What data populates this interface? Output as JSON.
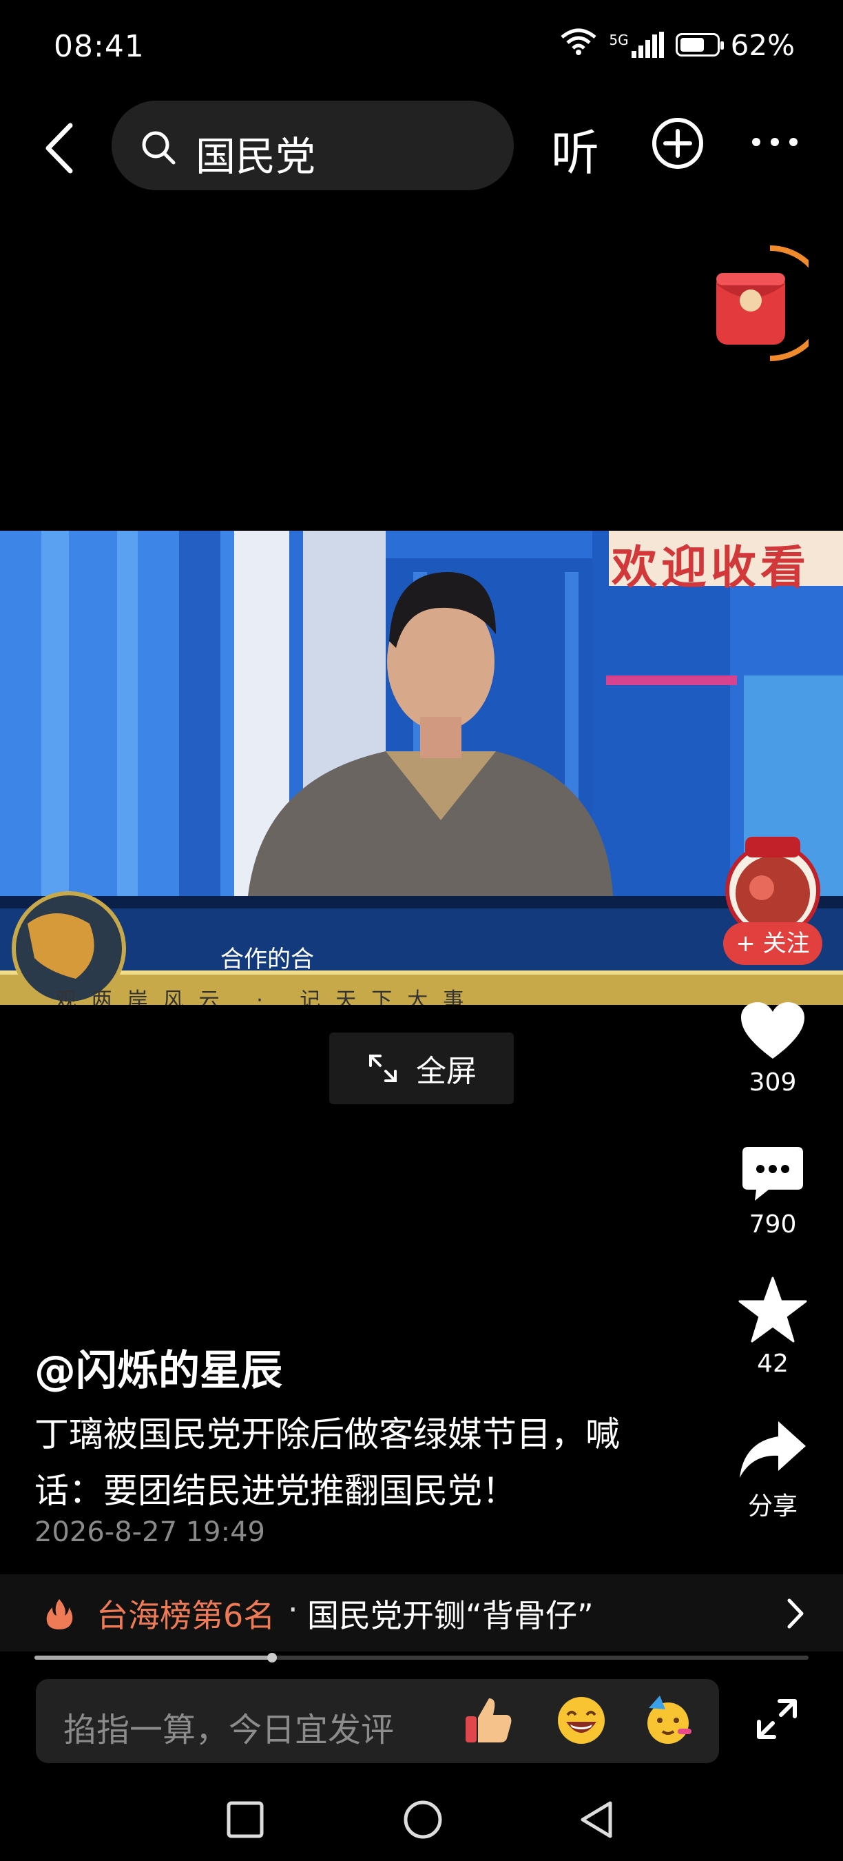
{
  "status_bar": {
    "time": "08:41",
    "network": "5G",
    "battery": "62%"
  },
  "top_bar": {
    "search_query": "国民党",
    "listen_label": "听"
  },
  "video": {
    "banner_text": "欢迎收看",
    "caption": "合作的合",
    "ticker": "观两岸风云 · 记天下大事",
    "follow_label": "+ 关注",
    "fullscreen_label": "全屏"
  },
  "actions": {
    "likes": "309",
    "comments": "790",
    "favorites": "42",
    "share_label": "分享"
  },
  "post": {
    "author": "@闪烁的星辰",
    "description": "丁璃被国民党开除后做客绿媒节目，喊话：要团结民进党推翻国民党！",
    "date": "2026-8-27 19:49"
  },
  "hot": {
    "rank_label": "台海榜第6名",
    "separator": "·",
    "topic": "国民党开铡“背骨仔”"
  },
  "playback": {
    "progress": 0.307
  },
  "comment": {
    "placeholder": "掐指一算，今日宜发评"
  },
  "colors": {
    "background": "#000000",
    "accent_orange": "#ef7b56",
    "follow_red": "#e2403f",
    "studio_blue": "#2a72d8"
  },
  "icons": [
    "back-icon",
    "search-icon",
    "plus-circle-icon",
    "more-icon",
    "red-packet-icon",
    "expand-icon",
    "heart-icon",
    "comment-icon",
    "star-icon",
    "share-icon",
    "fire-icon",
    "chevron-right-icon",
    "thumbs-up-emoji-icon",
    "laughing-emoji-icon",
    "party-emoji-icon",
    "fullscreen-icon",
    "square-nav-icon",
    "circle-nav-icon",
    "triangle-nav-icon"
  ]
}
